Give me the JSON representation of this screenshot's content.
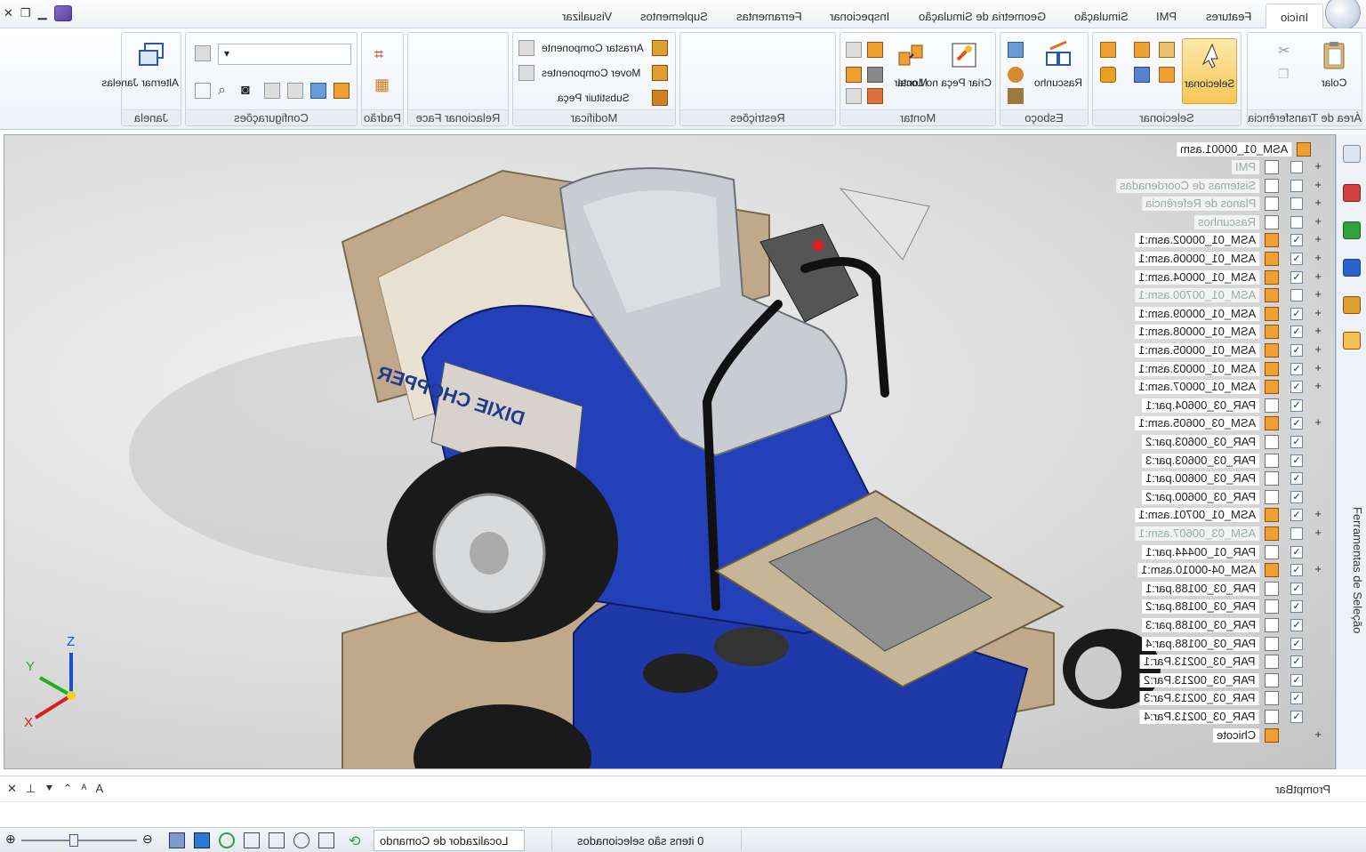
{
  "window": {
    "title_icon": "app-icon"
  },
  "tabs": [
    {
      "label": "Início"
    },
    {
      "label": "Features"
    },
    {
      "label": "PMI"
    },
    {
      "label": "Simulação"
    },
    {
      "label": "Geometria de Simulação"
    },
    {
      "label": "Inspecionar"
    },
    {
      "label": "Ferramentas"
    },
    {
      "label": "Suplementos"
    },
    {
      "label": "Visualizar"
    }
  ],
  "ribbon": {
    "groups": [
      {
        "label": "Área de Transferência",
        "buttons": [
          "Colar"
        ]
      },
      {
        "label": "Selecionar",
        "buttons": [
          "Selecionar"
        ]
      },
      {
        "label": "Esboço",
        "buttons": [
          "Rascunho"
        ]
      },
      {
        "label": "Montar",
        "buttons": [
          "Criar Peça no Local",
          "Montar"
        ]
      },
      {
        "label": "Restrições",
        "buttons": []
      },
      {
        "label": "Modificar",
        "buttons": [
          "Arrastar Componente",
          "Mover Componentes",
          "Substituir Peça"
        ]
      },
      {
        "label": "Relacionar Face",
        "buttons": []
      },
      {
        "label": "Padrão",
        "buttons": []
      },
      {
        "label": "Configurações",
        "buttons": []
      },
      {
        "label": "Janela",
        "buttons": [
          "Alternar Janelas"
        ]
      }
    ]
  },
  "tree": {
    "root": "ASM_01_00001.asm",
    "items": [
      {
        "label": "PMI",
        "checked": false,
        "dim": true,
        "expand": true
      },
      {
        "label": "Sistemas de Coordenadas",
        "checked": false,
        "dim": true,
        "expand": true
      },
      {
        "label": "Planos de Referência",
        "checked": false,
        "dim": true,
        "expand": true
      },
      {
        "label": "Rascunhos",
        "checked": false,
        "dim": true,
        "expand": true
      },
      {
        "label": "ASM_01_00002.asm:1",
        "checked": true,
        "dim": false,
        "expand": true
      },
      {
        "label": "ASM_01_00006.asm:1",
        "checked": true,
        "dim": false,
        "expand": true
      },
      {
        "label": "ASM_01_00004.asm:1",
        "checked": true,
        "dim": false,
        "expand": true
      },
      {
        "label": "ASM_01_00700.asm:1",
        "checked": false,
        "dim": true,
        "expand": true
      },
      {
        "label": "ASM_01_00009.asm:1",
        "checked": true,
        "dim": false,
        "expand": true
      },
      {
        "label": "ASM_01_00008.asm:1",
        "checked": true,
        "dim": false,
        "expand": true
      },
      {
        "label": "ASM_01_00005.asm:1",
        "checked": true,
        "dim": false,
        "expand": true
      },
      {
        "label": "ASM_01_00003.asm:1",
        "checked": true,
        "dim": false,
        "expand": true
      },
      {
        "label": "ASM_01_00007.asm:1",
        "checked": true,
        "dim": false,
        "expand": true
      },
      {
        "label": "PAR_03_00604.par:1",
        "checked": true,
        "dim": false,
        "expand": false
      },
      {
        "label": "ASM_03_00605.asm:1",
        "checked": true,
        "dim": false,
        "expand": true
      },
      {
        "label": "PAR_03_00603.par:2",
        "checked": true,
        "dim": false,
        "expand": false
      },
      {
        "label": "PAR_03_00603.par:3",
        "checked": true,
        "dim": false,
        "expand": false
      },
      {
        "label": "PAR_03_00600.par:1",
        "checked": true,
        "dim": false,
        "expand": false
      },
      {
        "label": "PAR_03_00600.par:2",
        "checked": true,
        "dim": false,
        "expand": false
      },
      {
        "label": "ASM_01_00701.asm:1",
        "checked": true,
        "dim": false,
        "expand": true
      },
      {
        "label": "ASM_03_00607.asm:1",
        "checked": false,
        "dim": true,
        "expand": true
      },
      {
        "label": "PAR_01_00444.par:1",
        "checked": true,
        "dim": false,
        "expand": false
      },
      {
        "label": "ASM_04-00010.asm:1",
        "checked": true,
        "dim": false,
        "expand": true
      },
      {
        "label": "PAR_03_00188.par:1",
        "checked": true,
        "dim": false,
        "expand": false
      },
      {
        "label": "PAR_03_00188.par:2",
        "checked": true,
        "dim": false,
        "expand": false
      },
      {
        "label": "PAR_03_00188.par:3",
        "checked": true,
        "dim": false,
        "expand": false
      },
      {
        "label": "PAR_03_00188.par:4",
        "checked": true,
        "dim": false,
        "expand": false
      },
      {
        "label": "PAR_03_00213.Par:1",
        "checked": true,
        "dim": false,
        "expand": false
      },
      {
        "label": "PAR_03_00213.Par:2",
        "checked": true,
        "dim": false,
        "expand": false
      },
      {
        "label": "PAR_03_00213.Par:3",
        "checked": true,
        "dim": false,
        "expand": false
      },
      {
        "label": "PAR_03_00213.Par:4",
        "checked": true,
        "dim": false,
        "expand": false
      },
      {
        "label": "Chicote",
        "checked": null,
        "dim": false,
        "expand": true
      }
    ]
  },
  "dock": {
    "label": "Ferramentas de Seleção"
  },
  "model": {
    "decal": "DIXIE CHOPPER"
  },
  "triad": {
    "x": "X",
    "y": "Y",
    "z": "Z"
  },
  "promptbar": {
    "label": "PromptBar"
  },
  "status": {
    "command_finder": "Localizador de Comando",
    "selection": "0 itens são selecionados"
  },
  "colors": {
    "accent": "#f7c65a",
    "body_blue": "#1f3aa8",
    "frame_tan": "#bfa98a"
  }
}
